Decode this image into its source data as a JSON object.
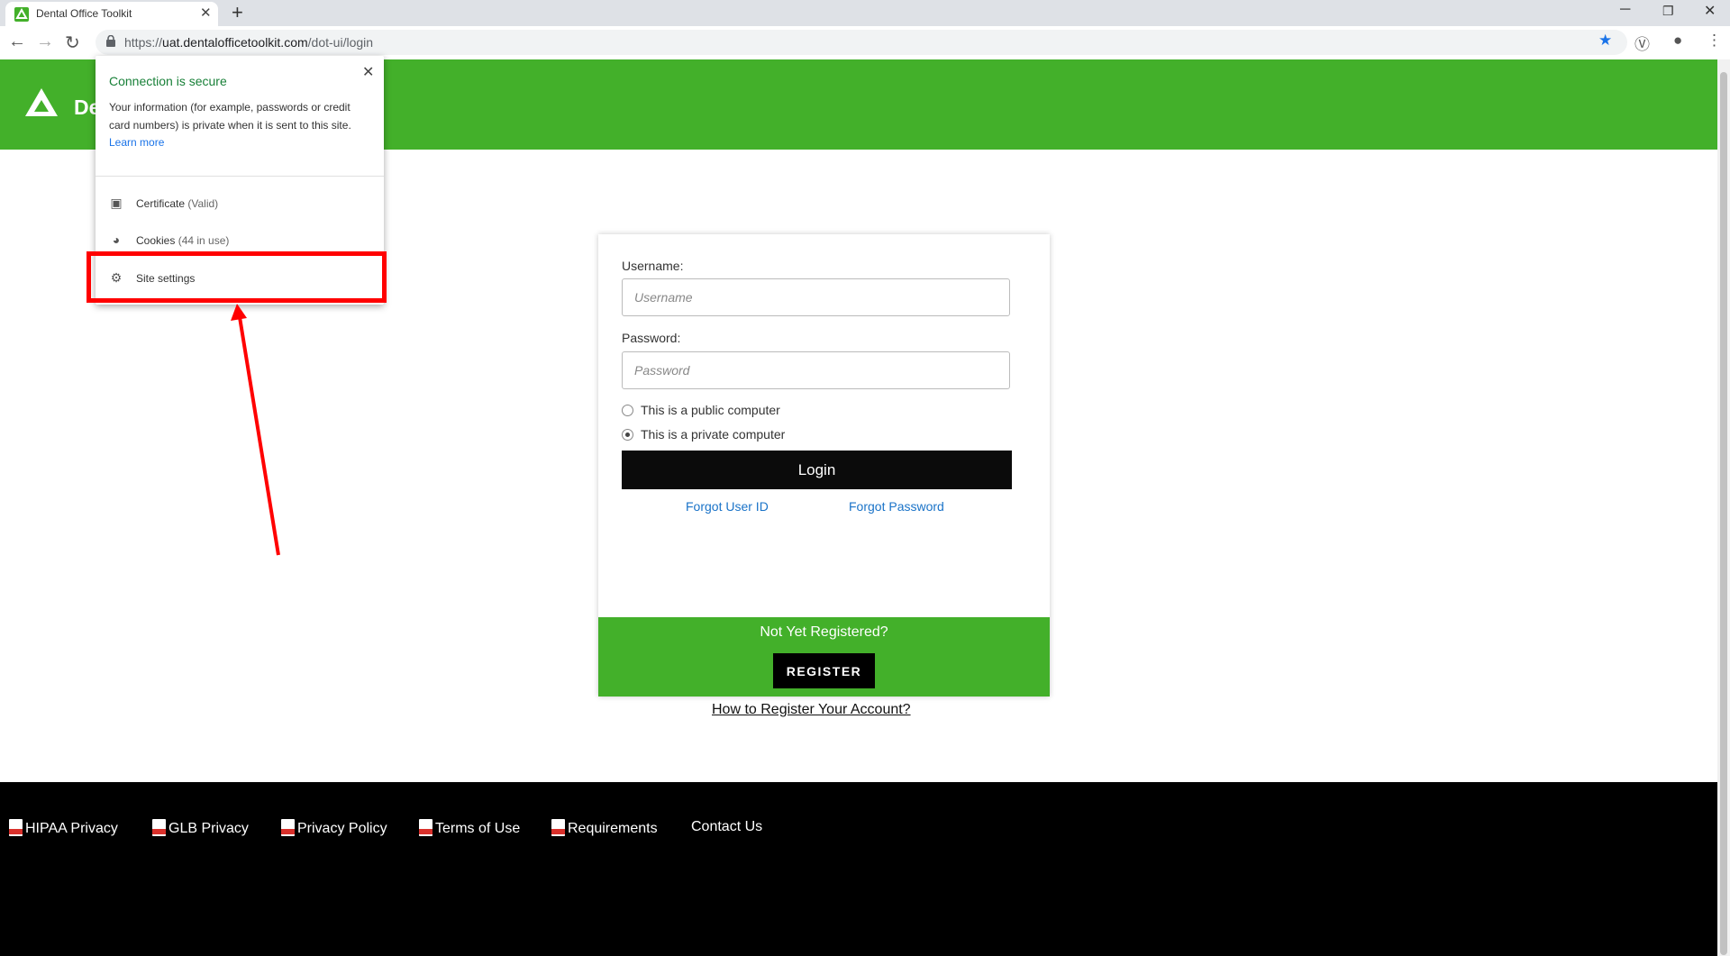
{
  "browser": {
    "tab_title": "Dental Office Toolkit",
    "url_prefix": "https://",
    "url_host": "uat.dentalofficetoolkit.com",
    "url_path": "/dot-ui/login"
  },
  "header": {
    "brand": "Dental Office Toolkit"
  },
  "popup": {
    "title": "Connection is secure",
    "description": "Your information (for example, passwords or credit card numbers) is private when it is sent to this site.",
    "learn_more": "Learn more",
    "certificate_label": "Certificate",
    "certificate_status": "(Valid)",
    "cookies_label": "Cookies",
    "cookies_status": "(44 in use)",
    "site_settings": "Site settings"
  },
  "login": {
    "username_label": "Username:",
    "username_placeholder": "Username",
    "password_label": "Password:",
    "password_placeholder": "Password",
    "public_computer": "This is a public computer",
    "private_computer": "This is a private computer",
    "selected_computer": "private",
    "login_button": "Login",
    "forgot_user_id": "Forgot User ID",
    "forgot_password": "Forgot Password",
    "not_registered": "Not Yet Registered?",
    "register_button": "REGISTER",
    "how_to_register": "How to Register Your Account?"
  },
  "footer": {
    "links": [
      "HIPAA Privacy",
      "GLB Privacy",
      "Privacy Policy",
      "Terms of Use",
      "Requirements",
      "Contact Us"
    ]
  },
  "colors": {
    "brand_green": "#43b02a",
    "highlight_red": "#ff0000"
  }
}
